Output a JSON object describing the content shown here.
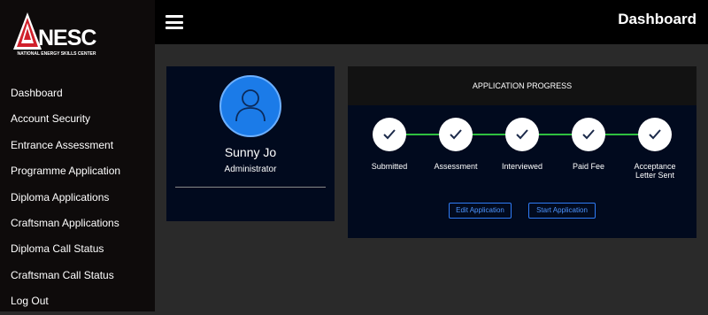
{
  "logo": {
    "word": "NESC",
    "subtitle": "NATIONAL ENERGY SKILLS CENTER"
  },
  "sidebar": {
    "items": [
      {
        "label": "Dashboard"
      },
      {
        "label": "Account Security"
      },
      {
        "label": "Entrance Assessment"
      },
      {
        "label": "Programme Application"
      },
      {
        "label": "Diploma Applications"
      },
      {
        "label": "Craftsman Applications"
      },
      {
        "label": "Diploma Call Status"
      },
      {
        "label": "Craftsman Call Status"
      },
      {
        "label": "Log Out"
      }
    ]
  },
  "header": {
    "title": "Dashboard"
  },
  "profile": {
    "name": "Sunny Jo",
    "role": "Administrator"
  },
  "progress": {
    "heading": "APPLICATION PROGRESS",
    "steps": [
      {
        "label": "Submitted",
        "icon": "check-icon",
        "done": true
      },
      {
        "label": "Assessment",
        "icon": "check-icon",
        "done": true
      },
      {
        "label": "Interviewed",
        "icon": "check-icon",
        "done": true
      },
      {
        "label": "Paid Fee",
        "icon": "check-icon",
        "done": true
      },
      {
        "label": "Acceptance Letter Sent",
        "icon": "check-icon",
        "done": true
      }
    ],
    "edit_label": "Edit Application",
    "start_label": "Start Application"
  },
  "colors": {
    "accent_blue": "#2f7cf6",
    "progress_green": "#2fbf40",
    "logo_red": "#d0202b",
    "card_bg": "#010a1e"
  }
}
